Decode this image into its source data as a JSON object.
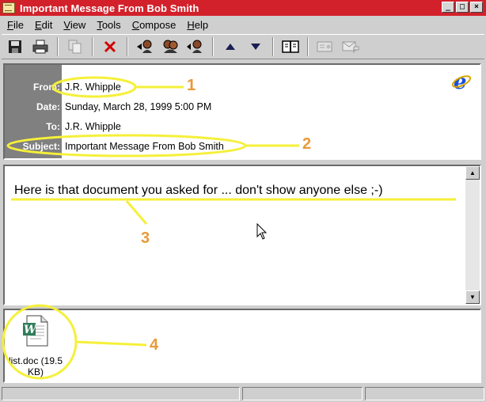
{
  "window": {
    "title": "Important Message From Bob Smith",
    "controls": [
      "_",
      "□",
      "×"
    ]
  },
  "menu": [
    {
      "label": "File",
      "accel": "F",
      "rest": "ile"
    },
    {
      "label": "Edit",
      "accel": "E",
      "rest": "dit"
    },
    {
      "label": "View",
      "accel": "V",
      "rest": "iew"
    },
    {
      "label": "Tools",
      "accel": "T",
      "rest": "ools"
    },
    {
      "label": "Compose",
      "accel": "C",
      "rest": "ompose"
    },
    {
      "label": "Help",
      "accel": "H",
      "rest": "elp"
    }
  ],
  "toolbar": {
    "icons": [
      "save-icon",
      "print-icon",
      "copy-icon",
      "delete-icon",
      "reply-icon",
      "reply-all-icon",
      "forward-icon",
      "previous-icon",
      "next-icon",
      "address-book-icon",
      "addresses-icon",
      "flag-icon"
    ]
  },
  "header": {
    "from_label": "From:",
    "from": "J.R. Whipple",
    "date_label": "Date:",
    "date": "Sunday, March 28, 1999 5:00 PM",
    "to_label": "To:",
    "to": "J.R. Whipple",
    "subject_label": "Subject:",
    "subject": "Important Message From Bob Smith"
  },
  "body": {
    "text": "Here is that document you asked for ... don't show anyone else ;-)"
  },
  "attachment": {
    "name": "list.doc (19.5 KB)"
  },
  "annotations": {
    "n1": "1",
    "n2": "2",
    "n3": "3",
    "n4": "4",
    "color": "#f5f03a",
    "number_color": "#e89a3a"
  },
  "colors": {
    "titlebar": "#d2212b",
    "label_column": "#808080"
  }
}
